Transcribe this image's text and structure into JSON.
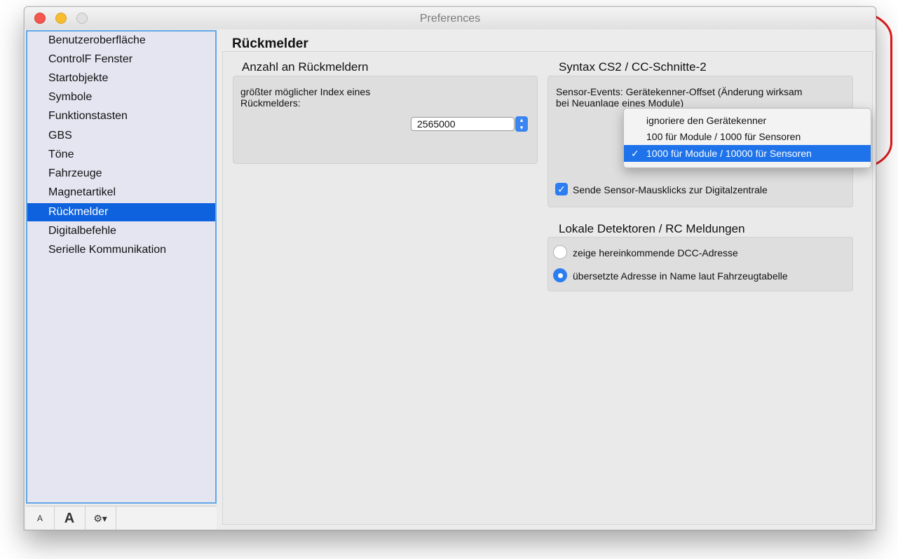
{
  "window": {
    "title": "Preferences"
  },
  "sidebar": {
    "items": [
      {
        "label": "Benutzeroberfläche"
      },
      {
        "label": "ControlF Fenster"
      },
      {
        "label": "Startobjekte"
      },
      {
        "label": "Symbole"
      },
      {
        "label": "Funktionstasten"
      },
      {
        "label": "GBS"
      },
      {
        "label": "Töne"
      },
      {
        "label": "Fahrzeuge"
      },
      {
        "label": "Magnetartikel"
      },
      {
        "label": "Rückmelder",
        "selected": true
      },
      {
        "label": "Digitalbefehle"
      },
      {
        "label": "Serielle Kommunikation"
      }
    ],
    "bottom_buttons": [
      {
        "label": "A",
        "icon": "font-smaller-icon"
      },
      {
        "label": "A",
        "icon": "font-larger-icon"
      },
      {
        "label": "⚙▾",
        "icon": "gear-menu-icon"
      }
    ]
  },
  "main": {
    "title": "Rückmelder",
    "anzahl": {
      "title": "Anzahl an Rückmeldern",
      "description": "größter möglicher Index eines Rückmelders:",
      "value": "2565000"
    },
    "syntax": {
      "title": "Syntax CS2 / CC-Schnitte-2",
      "sensor_label": "Sensor-Events: Gerätekenner-Offset (Änderung wirksam bei Neuanlage eines Module)",
      "options": [
        {
          "label": "ignoriere den Gerätekenner",
          "selected": false
        },
        {
          "label": "100 für Module / 1000 für Sensoren",
          "selected": false
        },
        {
          "label": "1000 für Module / 10000 für Sensoren",
          "selected": true
        }
      ],
      "checkbox_label": "Sende Sensor-Mausklicks zur Digitalzentrale",
      "checkbox_checked": true
    },
    "lokale": {
      "title": "Lokale Detektoren / RC Meldungen",
      "options": [
        {
          "label": "zeige hereinkommende DCC-Adresse",
          "selected": false
        },
        {
          "label": "übersetzte Adresse in Name laut Fahrzeugtabelle",
          "selected": true
        }
      ]
    }
  },
  "colors": {
    "selection": "#0f62de",
    "annotation": "#e2191a",
    "accent": "#2b7ef2"
  }
}
